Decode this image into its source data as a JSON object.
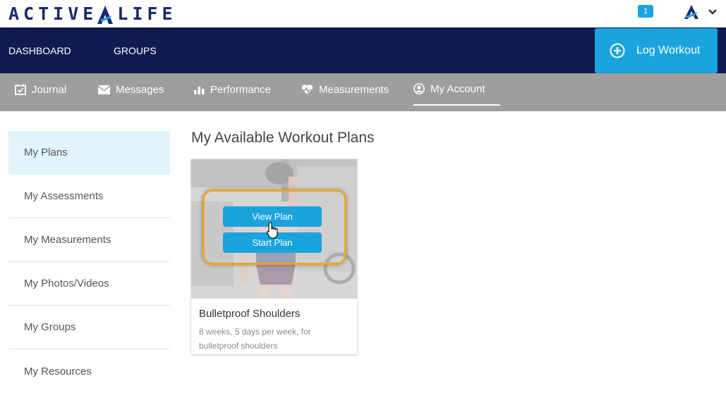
{
  "header": {
    "logo_text_left": "ACTIVE",
    "logo_text_right": "LIFE",
    "notification_count": "1",
    "brand_color": "#1b2a6b",
    "accent_color": "#1aa3dc"
  },
  "nav": {
    "dashboard": "DASHBOARD",
    "groups": "GROUPS",
    "log_workout": "Log Workout"
  },
  "subnav": {
    "journal": "Journal",
    "messages": "Messages",
    "performance": "Performance",
    "measurements": "Measurements",
    "my_account": "My Account"
  },
  "sidebar": {
    "items": [
      {
        "label": "My Plans",
        "active": true
      },
      {
        "label": "My Assessments",
        "active": false
      },
      {
        "label": "My Measurements",
        "active": false
      },
      {
        "label": "My Photos/Videos",
        "active": false
      },
      {
        "label": "My Groups",
        "active": false
      },
      {
        "label": "My Resources",
        "active": false
      }
    ]
  },
  "main": {
    "title": "My Available Workout Plans",
    "plan": {
      "title": "Bulletproof Shoulders",
      "description": "8 weeks, 5 days per week, for bulletproof shoulders",
      "view_label": "View Plan",
      "start_label": "Start Plan"
    }
  }
}
